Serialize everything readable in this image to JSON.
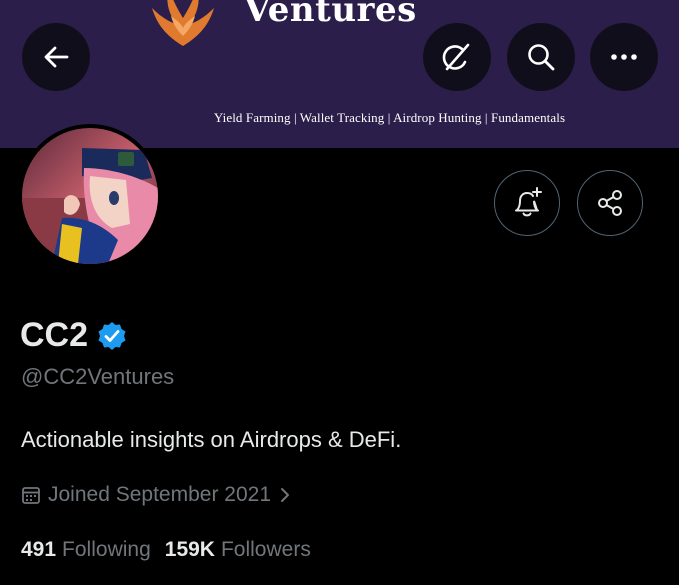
{
  "banner": {
    "title": "Ventures",
    "tagline": "Yield Farming | Wallet Tracking | Airdrop Hunting | Fundamentals",
    "color": "#2b1e4a",
    "logo_color": "#e07a2e"
  },
  "toolbar": {
    "back_icon": "arrow-left-icon",
    "grok_icon": "grok-icon",
    "search_icon": "search-icon",
    "more_icon": "more-icon"
  },
  "actions": {
    "notify_icon": "bell-plus-icon",
    "share_icon": "share-icon"
  },
  "profile": {
    "name": "CC2",
    "verified": true,
    "verified_color": "#1d9bf0",
    "handle": "@CC2Ventures",
    "bio": "Actionable insights on Airdrops & DeFi.",
    "joined": "Joined September 2021",
    "following_count": "491",
    "following_label": "Following",
    "followers_count": "159K",
    "followers_label": "Followers"
  }
}
